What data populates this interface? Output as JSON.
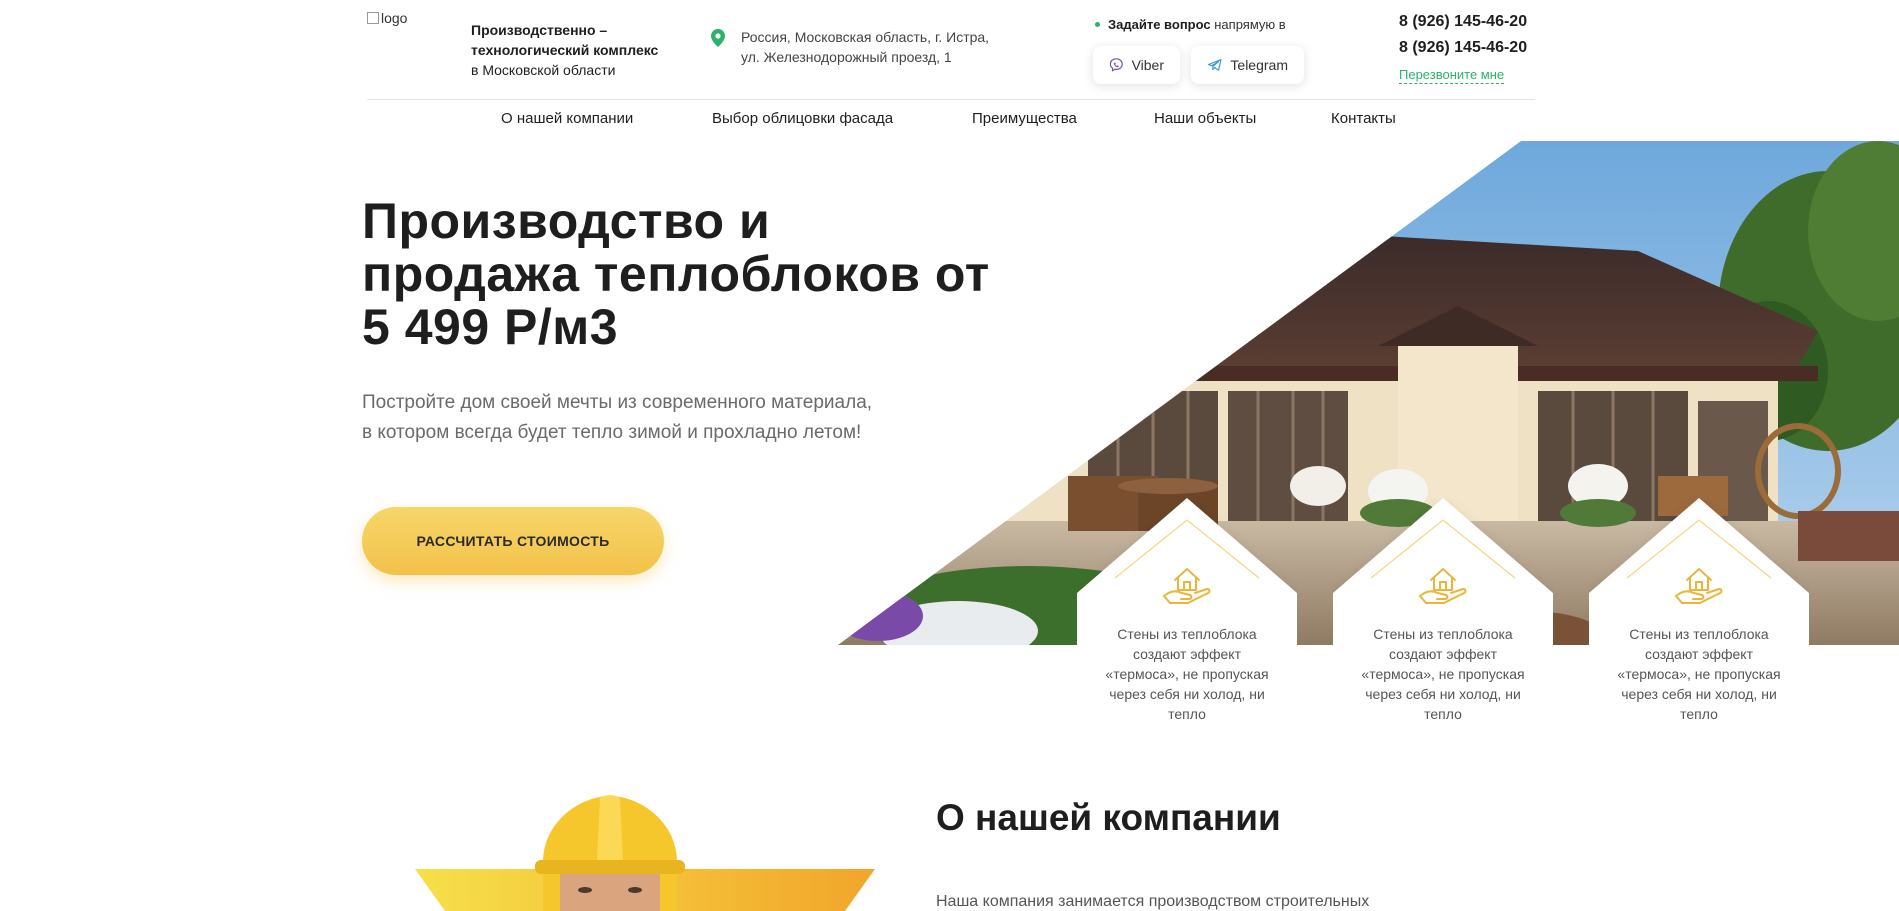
{
  "header": {
    "logo_alt": "logo",
    "company_line1": "Производственно –",
    "company_line2": "технологический комплекс",
    "company_line3": "в Московской области",
    "address_line1": "Россия, Московская область, г. Истра,",
    "address_line2": "ул. Железнодорожный проезд, 1",
    "ask_bold": "Задайте вопрос",
    "ask_rest": "напрямую в",
    "viber_label": "Viber",
    "telegram_label": "Telegram",
    "phone1": "8 (926) 145-46-20",
    "phone2": "8 (926) 145-46-20",
    "callback_label": "Перезвоните мне"
  },
  "nav": {
    "items": [
      {
        "label": "О нашей компании"
      },
      {
        "label": "Выбор облицовки фасада"
      },
      {
        "label": "Преимущества"
      },
      {
        "label": "Наши объекты"
      },
      {
        "label": "Контакты"
      }
    ]
  },
  "hero": {
    "title_line1": "Производство и",
    "title_line2": "продажа теплоблоков от",
    "title_line3": "5 499 Р/м3",
    "subtitle_line1": "Постройте дом своей мечты из современного материала,",
    "subtitle_line2": "в котором всегда будет тепло зимой и прохладно летом!",
    "cta_label": "РАССЧИТАТЬ СТОИМОСТЬ"
  },
  "features": [
    {
      "icon": "house-in-hand-icon",
      "text": "Стены из теплоблока создают эффект «термоса», не пропуская через себя ни холод, ни тепло"
    },
    {
      "icon": "house-in-hand-icon",
      "text": "Стены из теплоблока создают эффект «термоса», не пропуская через себя ни холод, ни тепло"
    },
    {
      "icon": "house-in-hand-icon",
      "text": "Стены из теплоблока создают эффект «термоса», не пропуская через себя ни холод, ни тепло"
    }
  ],
  "about": {
    "title": "О нашей компании",
    "text": "Наша компания занимается производством строительных"
  },
  "colors": {
    "accent_yellow": "#f2c24a",
    "accent_green": "#2bb36a",
    "text_dark": "#1e1e1e"
  }
}
